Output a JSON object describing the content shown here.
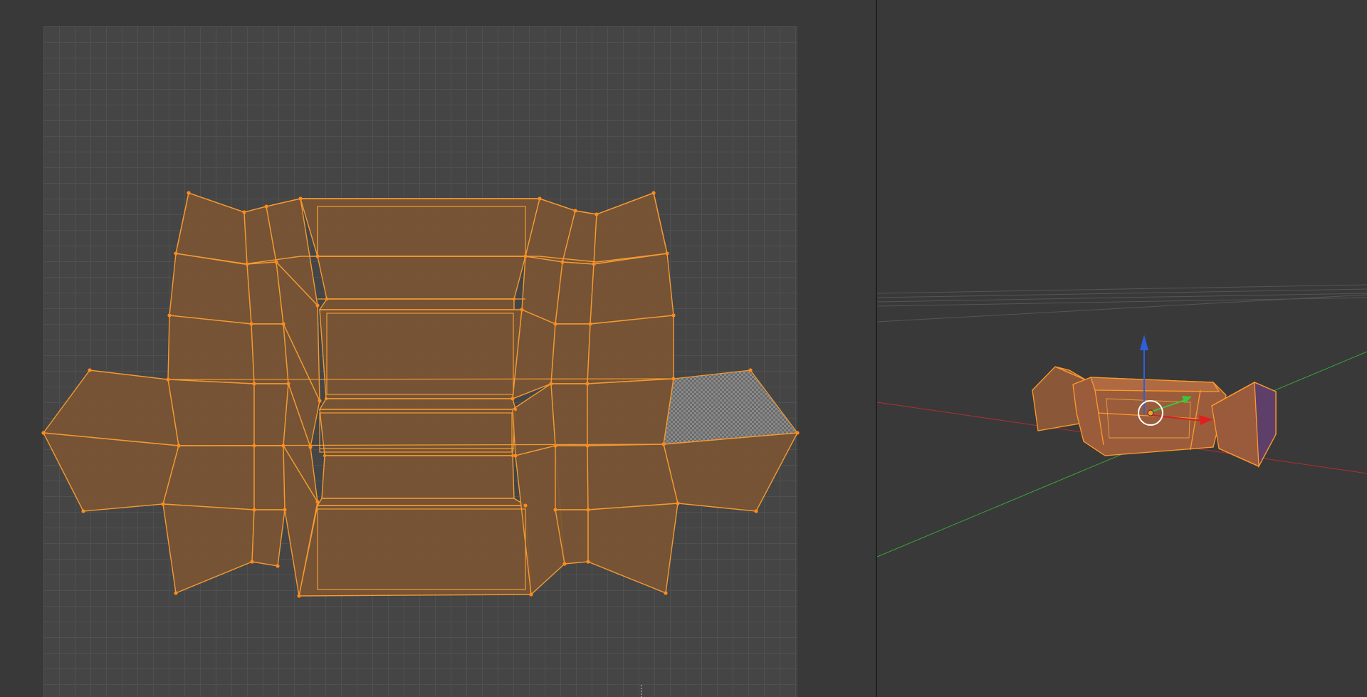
{
  "uv_editor": {
    "mesh_fill": "#7a5533",
    "edge_color": "#f39a32",
    "vertex_color": "#ff8a1c",
    "grid_color": "#454545",
    "selected_face_pattern": "checker-grey"
  },
  "viewport_3d": {
    "object": "candy-mesh",
    "x_axis_color": "#b03030",
    "y_axis_color": "#3aa33a",
    "z_axis_color": "#2f5fd8",
    "gizmo": [
      "translate-x-arrow",
      "translate-y-arrow",
      "translate-z-arrow",
      "pivot-circle"
    ]
  }
}
